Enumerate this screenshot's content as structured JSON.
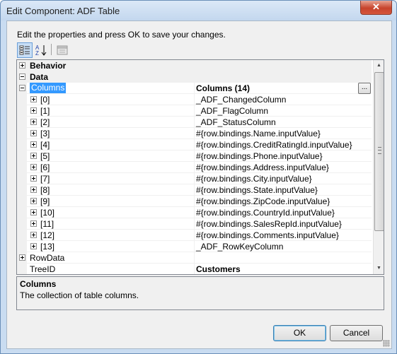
{
  "window": {
    "title": "Edit Component: ADF Table",
    "close_glyph": "✕"
  },
  "hint": "Edit the properties and press OK to save your changes.",
  "toolbar": {
    "buttons": [
      "categorized-icon",
      "alphabetical-icon",
      "property-pages-icon"
    ]
  },
  "grid": {
    "rows": [
      {
        "kind": "category",
        "name": "Behavior",
        "value": "",
        "expander": "collapsed"
      },
      {
        "kind": "category",
        "name": "Data",
        "value": "",
        "expander": "expanded"
      },
      {
        "kind": "property",
        "level": 0,
        "name": "Columns",
        "value": "Columns (14)",
        "value_bold": true,
        "selected": true,
        "expander": "expanded",
        "ellipsis": "..."
      },
      {
        "kind": "property",
        "level": 1,
        "name": "[0]",
        "value": "_ADF_ChangedColumn",
        "expander": "collapsed"
      },
      {
        "kind": "property",
        "level": 1,
        "name": "[1]",
        "value": "_ADF_FlagColumn",
        "expander": "collapsed"
      },
      {
        "kind": "property",
        "level": 1,
        "name": "[2]",
        "value": "_ADF_StatusColumn",
        "expander": "collapsed"
      },
      {
        "kind": "property",
        "level": 1,
        "name": "[3]",
        "value": "#{row.bindings.Name.inputValue}",
        "expander": "collapsed"
      },
      {
        "kind": "property",
        "level": 1,
        "name": "[4]",
        "value": "#{row.bindings.CreditRatingId.inputValue}",
        "expander": "collapsed"
      },
      {
        "kind": "property",
        "level": 1,
        "name": "[5]",
        "value": "#{row.bindings.Phone.inputValue}",
        "expander": "collapsed"
      },
      {
        "kind": "property",
        "level": 1,
        "name": "[6]",
        "value": "#{row.bindings.Address.inputValue}",
        "expander": "collapsed"
      },
      {
        "kind": "property",
        "level": 1,
        "name": "[7]",
        "value": "#{row.bindings.City.inputValue}",
        "expander": "collapsed"
      },
      {
        "kind": "property",
        "level": 1,
        "name": "[8]",
        "value": "#{row.bindings.State.inputValue}",
        "expander": "collapsed"
      },
      {
        "kind": "property",
        "level": 1,
        "name": "[9]",
        "value": "#{row.bindings.ZipCode.inputValue}",
        "expander": "collapsed"
      },
      {
        "kind": "property",
        "level": 1,
        "name": "[10]",
        "value": "#{row.bindings.CountryId.inputValue}",
        "expander": "collapsed"
      },
      {
        "kind": "property",
        "level": 1,
        "name": "[11]",
        "value": "#{row.bindings.SalesRepId.inputValue}",
        "expander": "collapsed"
      },
      {
        "kind": "property",
        "level": 1,
        "name": "[12]",
        "value": "#{row.bindings.Comments.inputValue}",
        "expander": "collapsed"
      },
      {
        "kind": "property",
        "level": 1,
        "name": "[13]",
        "value": "_ADF_RowKeyColumn",
        "expander": "collapsed"
      },
      {
        "kind": "property",
        "level": 0,
        "name": "RowData",
        "value": "",
        "expander": "collapsed"
      },
      {
        "kind": "property",
        "level": 0,
        "name": "TreeID",
        "value": "Customers",
        "value_bold": true,
        "expander": "none"
      }
    ],
    "scroll_position": 0.0
  },
  "description": {
    "title": "Columns",
    "text": "The collection of table columns."
  },
  "buttons": {
    "ok": "OK",
    "cancel": "Cancel"
  }
}
